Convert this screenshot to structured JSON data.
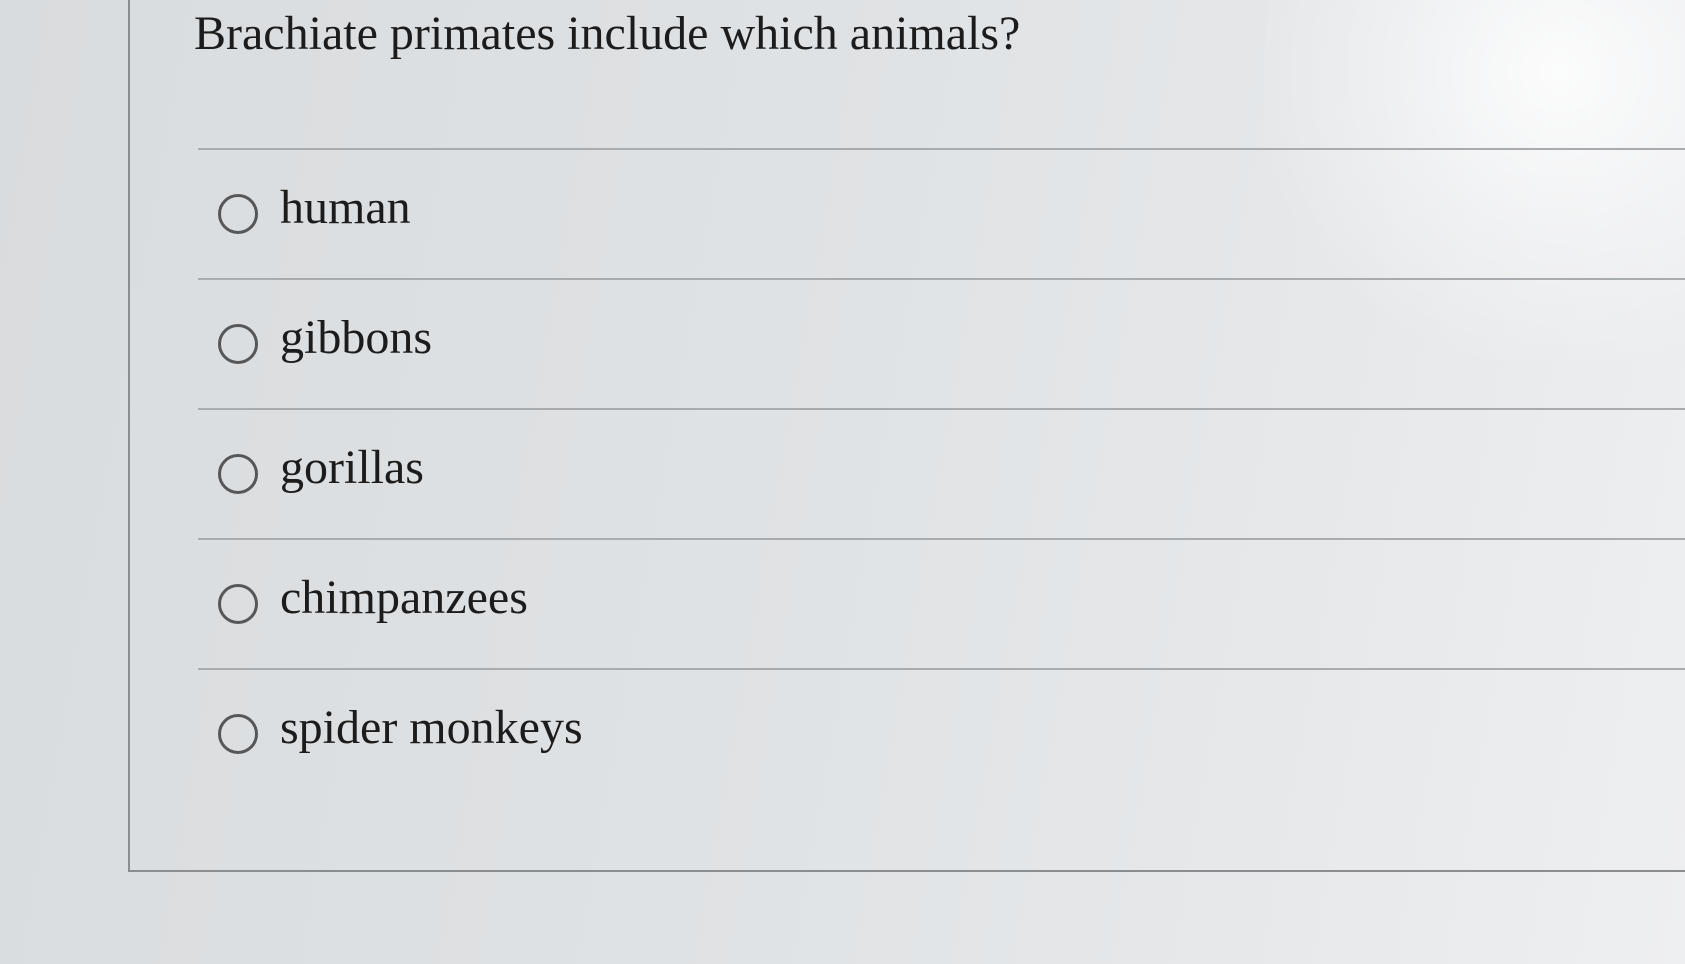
{
  "question": {
    "text": "Brachiate primates include which animals?"
  },
  "options": [
    {
      "label": "human",
      "selected": false
    },
    {
      "label": "gibbons",
      "selected": false
    },
    {
      "label": "gorillas",
      "selected": false
    },
    {
      "label": "chimpanzees",
      "selected": false
    },
    {
      "label": "spider monkeys",
      "selected": false
    }
  ]
}
